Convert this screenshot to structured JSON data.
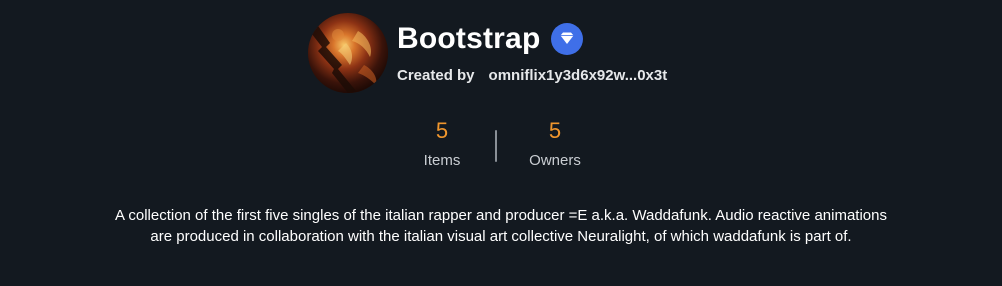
{
  "collection": {
    "title": "Bootstrap",
    "verified_icon": "verified-badge-icon",
    "creator_label": "Created by",
    "creator_address": "omniflix1y3d6x92w...0x3t"
  },
  "stats": {
    "items_value": "5",
    "items_label": "Items",
    "owners_value": "5",
    "owners_label": "Owners"
  },
  "description": {
    "line1": "A collection of the first five singles of the italian rapper and producer =E a.k.a. Waddafunk. Audio reactive animations",
    "line2": "are produced in collaboration with the italian visual art collective Neuralight, of which waddafunk is part of."
  },
  "colors": {
    "background": "#131920",
    "accent_orange": "#f0962d",
    "badge_blue": "#3f6fe8"
  }
}
